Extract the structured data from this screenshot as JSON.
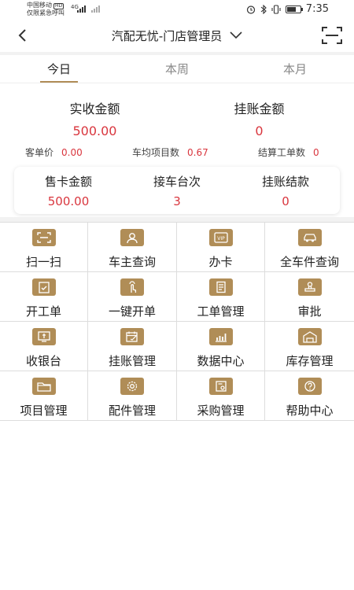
{
  "status_bar": {
    "carrier": "中国移动",
    "carrier_badge": "HD",
    "emergency": "仅限紧急呼叫",
    "signal_label": "4G",
    "time": "7:35"
  },
  "header": {
    "title": "汽配无忧-门店管理员"
  },
  "tabs": [
    {
      "label": "今日",
      "active": true
    },
    {
      "label": "本周",
      "active": false
    },
    {
      "label": "本月",
      "active": false
    }
  ],
  "summary": {
    "received": {
      "label": "实收金额",
      "value": "500.00"
    },
    "on_account": {
      "label": "挂账金额",
      "value": "0"
    }
  },
  "small_stats": [
    {
      "label": "客单价",
      "value": "0.00"
    },
    {
      "label": "车均项目数",
      "value": "0.67"
    },
    {
      "label": "结算工单数",
      "value": "0"
    }
  ],
  "card": [
    {
      "label": "售卡金额",
      "value": "500.00"
    },
    {
      "label": "接车台次",
      "value": "3"
    },
    {
      "label": "挂账结款",
      "value": "0"
    }
  ],
  "menu": [
    {
      "label": "扫一扫",
      "icon": "scan-icon"
    },
    {
      "label": "车主查询",
      "icon": "user-icon"
    },
    {
      "label": "办卡",
      "icon": "vip-card-icon"
    },
    {
      "label": "全车件查询",
      "icon": "car-icon"
    },
    {
      "label": "开工单",
      "icon": "clipboard-check-icon"
    },
    {
      "label": "一键开单",
      "icon": "tap-icon"
    },
    {
      "label": "工单管理",
      "icon": "document-icon"
    },
    {
      "label": "审批",
      "icon": "stamp-icon"
    },
    {
      "label": "收银台",
      "icon": "cashier-icon"
    },
    {
      "label": "挂账管理",
      "icon": "calendar-edit-icon"
    },
    {
      "label": "数据中心",
      "icon": "chart-icon"
    },
    {
      "label": "库存管理",
      "icon": "warehouse-icon"
    },
    {
      "label": "项目管理",
      "icon": "folder-icon"
    },
    {
      "label": "配件管理",
      "icon": "gear-icon"
    },
    {
      "label": "采购管理",
      "icon": "purchase-icon"
    },
    {
      "label": "帮助中心",
      "icon": "help-icon"
    }
  ],
  "colors": {
    "accent": "#b08d57",
    "value_red": "#d9363e"
  }
}
